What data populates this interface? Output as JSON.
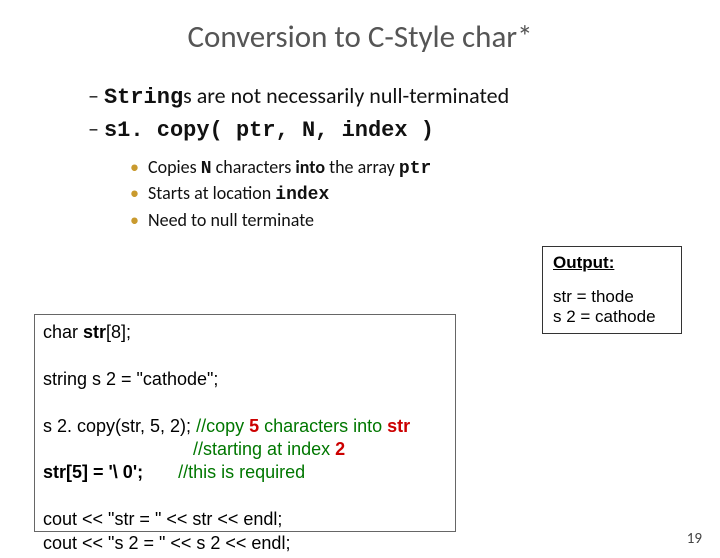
{
  "title": "Conversion to C-Style char*",
  "dash": {
    "item1_pre": "String",
    "item1_post": "s are not necessarily null-terminated",
    "item2": "s1. copy( ptr, N, index )"
  },
  "bullets": {
    "b1_pre": "Copies ",
    "b1_n": "N",
    "b1_mid": " characters ",
    "b1_into": "into",
    "b1_mid2": " the array ",
    "b1_ptr": "ptr",
    "b2_pre": "Starts at location ",
    "b2_index": "index",
    "b3": "Need to null terminate"
  },
  "code": {
    "l1_a": "char ",
    "l1_b": "str",
    "l1_c": "[8];",
    "l2": "string s 2 = \"cathode\";",
    "l3_a": "s 2. copy(str, 5, 2); ",
    "l3_cmt_a": "//copy ",
    "l3_five": "5",
    "l3_cmt_b": " characters into ",
    "l3_str": "str",
    "l4_a": "                              ",
    "l4_cmt_a": "//starting at index ",
    "l4_two": "2",
    "l5_a": "str[5] = '\\ 0';       ",
    "l5_cmt": "//this is required",
    "l6": "cout << \"str = \" << str << endl;",
    "l7": "cout << \"s 2 = \" << s 2 << endl;"
  },
  "output": {
    "header": "Output:",
    "line1": "str = thode",
    "line2": "s 2 = cathode"
  },
  "page_number": "19"
}
